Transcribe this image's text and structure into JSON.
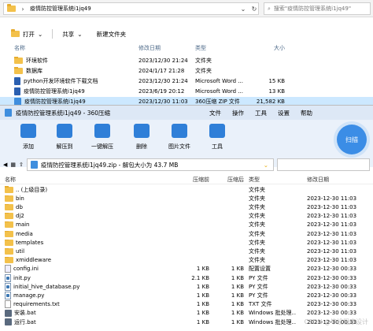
{
  "explorer": {
    "address": "疫情防控管理系统i1jq49",
    "search_placeholder": "搜索\"疫情防控管理系统i1jq49\"",
    "toolbar": {
      "open": "打开",
      "share": "共享",
      "new_folder": "新建文件夹"
    },
    "columns": {
      "name": "名称",
      "date": "修改日期",
      "type": "类型",
      "size": "大小"
    },
    "rows": [
      {
        "name": "环境软件",
        "date": "2023/12/30 21:24",
        "type": "文件夹",
        "size": "",
        "icon": "folder-icon"
      },
      {
        "name": "数据库",
        "date": "2024/1/17 21:28",
        "type": "文件夹",
        "size": "",
        "icon": "folder-icon"
      },
      {
        "name": "python开发环境软件下载文档",
        "date": "2023/12/30 21:24",
        "type": "Microsoft Word ...",
        "size": "15 KB",
        "icon": "word-icon"
      },
      {
        "name": "疫情防控管理系统i1jq49",
        "date": "2023/6/19 20:12",
        "type": "Microsoft Word ...",
        "size": "13 KB",
        "icon": "word-icon"
      },
      {
        "name": "疫情防控管理系统i1jq49",
        "date": "2023/12/30 11:03",
        "type": "360压缩 ZIP 文件",
        "size": "21,582 KB",
        "icon": "zip-icon"
      }
    ]
  },
  "zip": {
    "title": "疫情防控管理系统i1jq49 - 360压缩",
    "menu": [
      "文件",
      "操作",
      "工具",
      "设置",
      "帮助"
    ],
    "ribbon": [
      "添加",
      "解压到",
      "一键解压",
      "删除",
      "图片文件",
      "工具"
    ],
    "scan_label": "扫描",
    "path": "疫情防控管理系统i1jq49.zip - 解包大小为 43.7 MB",
    "columns": {
      "name": "名称",
      "compressed": "压缩前",
      "original": "压缩后",
      "type": "类型",
      "date": "修改日期"
    },
    "rows": [
      {
        "name": ".. (上级目录)",
        "comp": "",
        "orig": "",
        "type": "文件夹",
        "date": "",
        "icon": "folder-icon"
      },
      {
        "name": "bin",
        "comp": "",
        "orig": "",
        "type": "文件夹",
        "date": "2023-12-30 11:03",
        "icon": "folder-icon"
      },
      {
        "name": "db",
        "comp": "",
        "orig": "",
        "type": "文件夹",
        "date": "2023-12-30 11:03",
        "icon": "folder-icon"
      },
      {
        "name": "dj2",
        "comp": "",
        "orig": "",
        "type": "文件夹",
        "date": "2023-12-30 11:03",
        "icon": "folder-icon"
      },
      {
        "name": "main",
        "comp": "",
        "orig": "",
        "type": "文件夹",
        "date": "2023-12-30 11:03",
        "icon": "folder-icon"
      },
      {
        "name": "media",
        "comp": "",
        "orig": "",
        "type": "文件夹",
        "date": "2023-12-30 11:03",
        "icon": "folder-icon"
      },
      {
        "name": "templates",
        "comp": "",
        "orig": "",
        "type": "文件夹",
        "date": "2023-12-30 11:03",
        "icon": "folder-icon"
      },
      {
        "name": "util",
        "comp": "",
        "orig": "",
        "type": "文件夹",
        "date": "2023-12-30 11:03",
        "icon": "folder-icon"
      },
      {
        "name": "xmiddleware",
        "comp": "",
        "orig": "",
        "type": "文件夹",
        "date": "2023-12-30 11:03",
        "icon": "folder-icon"
      },
      {
        "name": "config.ini",
        "comp": "1 KB",
        "orig": "1 KB",
        "type": "配置设置",
        "date": "2023-12-30 00:33",
        "icon": "ini-icon"
      },
      {
        "name": "init.py",
        "comp": "2.1 KB",
        "orig": "1 KB",
        "type": "PY 文件",
        "date": "2023-12-30 00:33",
        "icon": "py-icon"
      },
      {
        "name": "initial_hive_database.py",
        "comp": "1 KB",
        "orig": "1 KB",
        "type": "PY 文件",
        "date": "2023-12-30 00:33",
        "icon": "py-icon"
      },
      {
        "name": "manage.py",
        "comp": "1 KB",
        "orig": "1 KB",
        "type": "PY 文件",
        "date": "2023-12-30 00:33",
        "icon": "py-icon"
      },
      {
        "name": "requirements.txt",
        "comp": "1 KB",
        "orig": "1 KB",
        "type": "TXT 文件",
        "date": "2023-12-30 00:33",
        "icon": "txt-icon"
      },
      {
        "name": "安装.bat",
        "comp": "1 KB",
        "orig": "1 KB",
        "type": "Windows 批处理...",
        "date": "2023-12-30 00:33",
        "icon": "bat-icon"
      },
      {
        "name": "运行.bat",
        "comp": "1 KB",
        "orig": "1 KB",
        "type": "Windows 批处理...",
        "date": "2023-12-30 00:33",
        "icon": "bat-icon"
      }
    ],
    "watermark": "CSDN @毕设程序设计"
  }
}
